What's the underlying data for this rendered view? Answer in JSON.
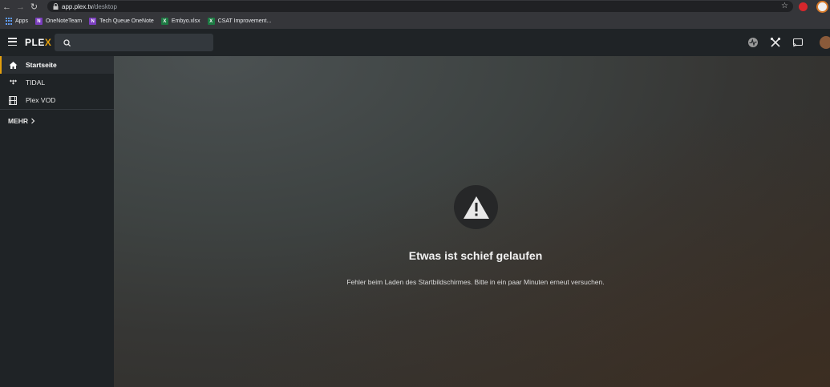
{
  "browser": {
    "url_host": "app.plex.tv",
    "url_path": "/desktop",
    "bookmarks": [
      {
        "label": "Apps",
        "icon": "apps-grid-icon"
      },
      {
        "label": "OneNoteTeam",
        "icon": "onenote-icon"
      },
      {
        "label": "Tech Queue OneNote",
        "icon": "onenote-icon"
      },
      {
        "label": "Embyo.xlsx",
        "icon": "excel-icon"
      },
      {
        "label": "CSAT Improvement...",
        "icon": "excel-icon"
      }
    ]
  },
  "header": {
    "logo_main": "PLE",
    "logo_accent": "X",
    "accent_color": "#e5a00d"
  },
  "sidebar": {
    "items": [
      {
        "label": "Startseite",
        "icon": "home-icon",
        "active": true
      },
      {
        "label": "TIDAL",
        "icon": "tidal-icon",
        "active": false
      },
      {
        "label": "Plex VOD",
        "icon": "film-icon",
        "active": false
      }
    ],
    "more_label": "MEHR"
  },
  "main": {
    "error_title": "Etwas ist schief gelaufen",
    "error_message": "Fehler beim Laden des Startbildschirmes. Bitte in ein paar Minuten erneut versuchen."
  }
}
